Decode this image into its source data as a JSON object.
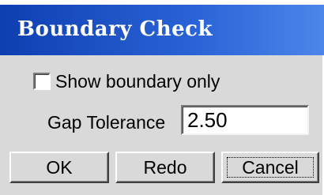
{
  "window": {
    "title": "Boundary Check"
  },
  "options": {
    "show_boundary_only": {
      "label": "Show boundary only",
      "checked": false
    }
  },
  "gap_tolerance": {
    "label": "Gap Tolerance",
    "value": "2.50"
  },
  "buttons": {
    "ok": "OK",
    "redo": "Redo",
    "cancel": "Cancel"
  }
}
